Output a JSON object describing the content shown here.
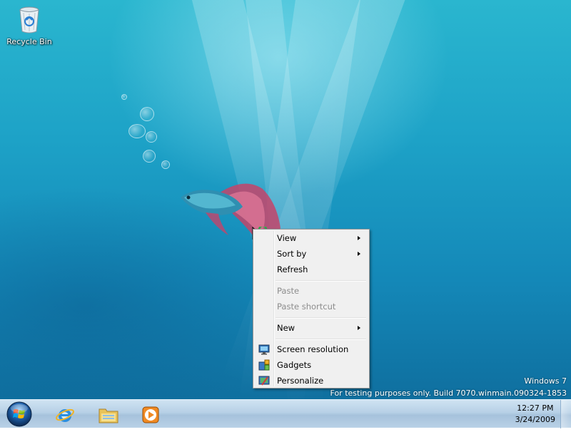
{
  "desktop": {
    "icons": [
      {
        "label": "Recycle Bin",
        "icon": "recycle-bin-icon"
      }
    ],
    "watermark": {
      "line1": "Windows 7",
      "line2": "For testing purposes only. Build 7070.winmain.090324-1853"
    }
  },
  "context_menu": {
    "items": [
      {
        "label": "View",
        "submenu": true,
        "enabled": true
      },
      {
        "label": "Sort by",
        "submenu": true,
        "enabled": true
      },
      {
        "label": "Refresh",
        "submenu": false,
        "enabled": true
      },
      {
        "label": "Paste",
        "submenu": false,
        "enabled": false
      },
      {
        "label": "Paste shortcut",
        "submenu": false,
        "enabled": false
      },
      {
        "label": "New",
        "submenu": true,
        "enabled": true
      },
      {
        "label": "Screen resolution",
        "submenu": false,
        "enabled": true,
        "icon": "screen-resolution-icon"
      },
      {
        "label": "Gadgets",
        "submenu": false,
        "enabled": true,
        "icon": "gadgets-icon"
      },
      {
        "label": "Personalize",
        "submenu": false,
        "enabled": true,
        "icon": "personalize-icon"
      }
    ]
  },
  "taskbar": {
    "start_icon": "windows-start-orb-icon",
    "pinned": [
      {
        "name": "Internet Explorer",
        "icon": "internet-explorer-icon"
      },
      {
        "name": "Windows Explorer",
        "icon": "folder-explorer-icon"
      },
      {
        "name": "Windows Media Player",
        "icon": "media-player-icon"
      }
    ],
    "clock": {
      "time": "12:27 PM",
      "date": "3/24/2009"
    }
  }
}
